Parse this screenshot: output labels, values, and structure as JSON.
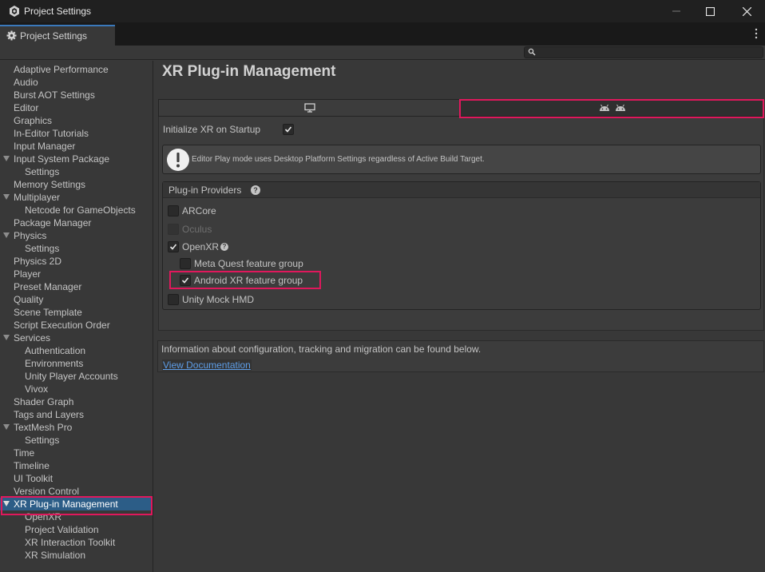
{
  "window": {
    "title": "Project Settings",
    "controls": {
      "minimize": "—",
      "maximize": "☐",
      "close": "✕"
    }
  },
  "tabbar": {
    "tab_label": "Project Settings"
  },
  "search": {
    "placeholder": "",
    "value": ""
  },
  "sidebar": {
    "items": [
      {
        "label": "Adaptive Performance",
        "level": 0,
        "expanded": false
      },
      {
        "label": "Audio",
        "level": 0
      },
      {
        "label": "Burst AOT Settings",
        "level": 0
      },
      {
        "label": "Editor",
        "level": 0
      },
      {
        "label": "Graphics",
        "level": 0
      },
      {
        "label": "In-Editor Tutorials",
        "level": 0
      },
      {
        "label": "Input Manager",
        "level": 0
      },
      {
        "label": "Input System Package",
        "level": 0,
        "expanded": true
      },
      {
        "label": "Settings",
        "level": 1
      },
      {
        "label": "Memory Settings",
        "level": 0
      },
      {
        "label": "Multiplayer",
        "level": 0,
        "expanded": true
      },
      {
        "label": "Netcode for GameObjects",
        "level": 1
      },
      {
        "label": "Package Manager",
        "level": 0
      },
      {
        "label": "Physics",
        "level": 0,
        "expanded": true
      },
      {
        "label": "Settings",
        "level": 1
      },
      {
        "label": "Physics 2D",
        "level": 0
      },
      {
        "label": "Player",
        "level": 0
      },
      {
        "label": "Preset Manager",
        "level": 0
      },
      {
        "label": "Quality",
        "level": 0
      },
      {
        "label": "Scene Template",
        "level": 0
      },
      {
        "label": "Script Execution Order",
        "level": 0
      },
      {
        "label": "Services",
        "level": 0,
        "expanded": true
      },
      {
        "label": "Authentication",
        "level": 1
      },
      {
        "label": "Environments",
        "level": 1
      },
      {
        "label": "Unity Player Accounts",
        "level": 1
      },
      {
        "label": "Vivox",
        "level": 1
      },
      {
        "label": "Shader Graph",
        "level": 0
      },
      {
        "label": "Tags and Layers",
        "level": 0
      },
      {
        "label": "TextMesh Pro",
        "level": 0,
        "expanded": true
      },
      {
        "label": "Settings",
        "level": 1
      },
      {
        "label": "Time",
        "level": 0
      },
      {
        "label": "Timeline",
        "level": 0
      },
      {
        "label": "UI Toolkit",
        "level": 0
      },
      {
        "label": "Version Control",
        "level": 0
      },
      {
        "label": "XR Plug-in Management",
        "level": 0,
        "expanded": true,
        "selected": true
      },
      {
        "label": "OpenXR",
        "level": 1
      },
      {
        "label": "Project Validation",
        "level": 1
      },
      {
        "label": "XR Interaction Toolkit",
        "level": 1
      },
      {
        "label": "XR Simulation",
        "level": 1
      }
    ]
  },
  "main": {
    "title": "XR Plug-in Management",
    "platform_tabs": [
      {
        "icon": "desktop-monitor-icon",
        "selected": false
      },
      {
        "icon": "android-icon",
        "selected": true
      }
    ],
    "initialize_label": "Initialize XR on Startup",
    "initialize_checked": true,
    "help_message": "Editor Play mode uses Desktop Platform Settings regardless of Active Build Target.",
    "providers_header": "Plug-in Providers",
    "providers": [
      {
        "label": "ARCore",
        "checked": false,
        "disabled": false
      },
      {
        "label": "Oculus",
        "checked": false,
        "disabled": true
      },
      {
        "label": "OpenXR",
        "checked": true,
        "disabled": false
      },
      {
        "label": "Meta Quest feature group",
        "checked": false,
        "disabled": false
      },
      {
        "label": "Android XR feature group",
        "checked": true,
        "disabled": false
      },
      {
        "label": "Unity Mock HMD",
        "checked": false,
        "disabled": false
      }
    ],
    "info_text": "Information about configuration, tracking and migration can be found below.",
    "doc_link": "View Documentation"
  },
  "colors": {
    "highlight": "#e0185c",
    "selection": "#2c5d87",
    "link": "#5e9ee8",
    "tab_accent": "#3a79bb"
  }
}
